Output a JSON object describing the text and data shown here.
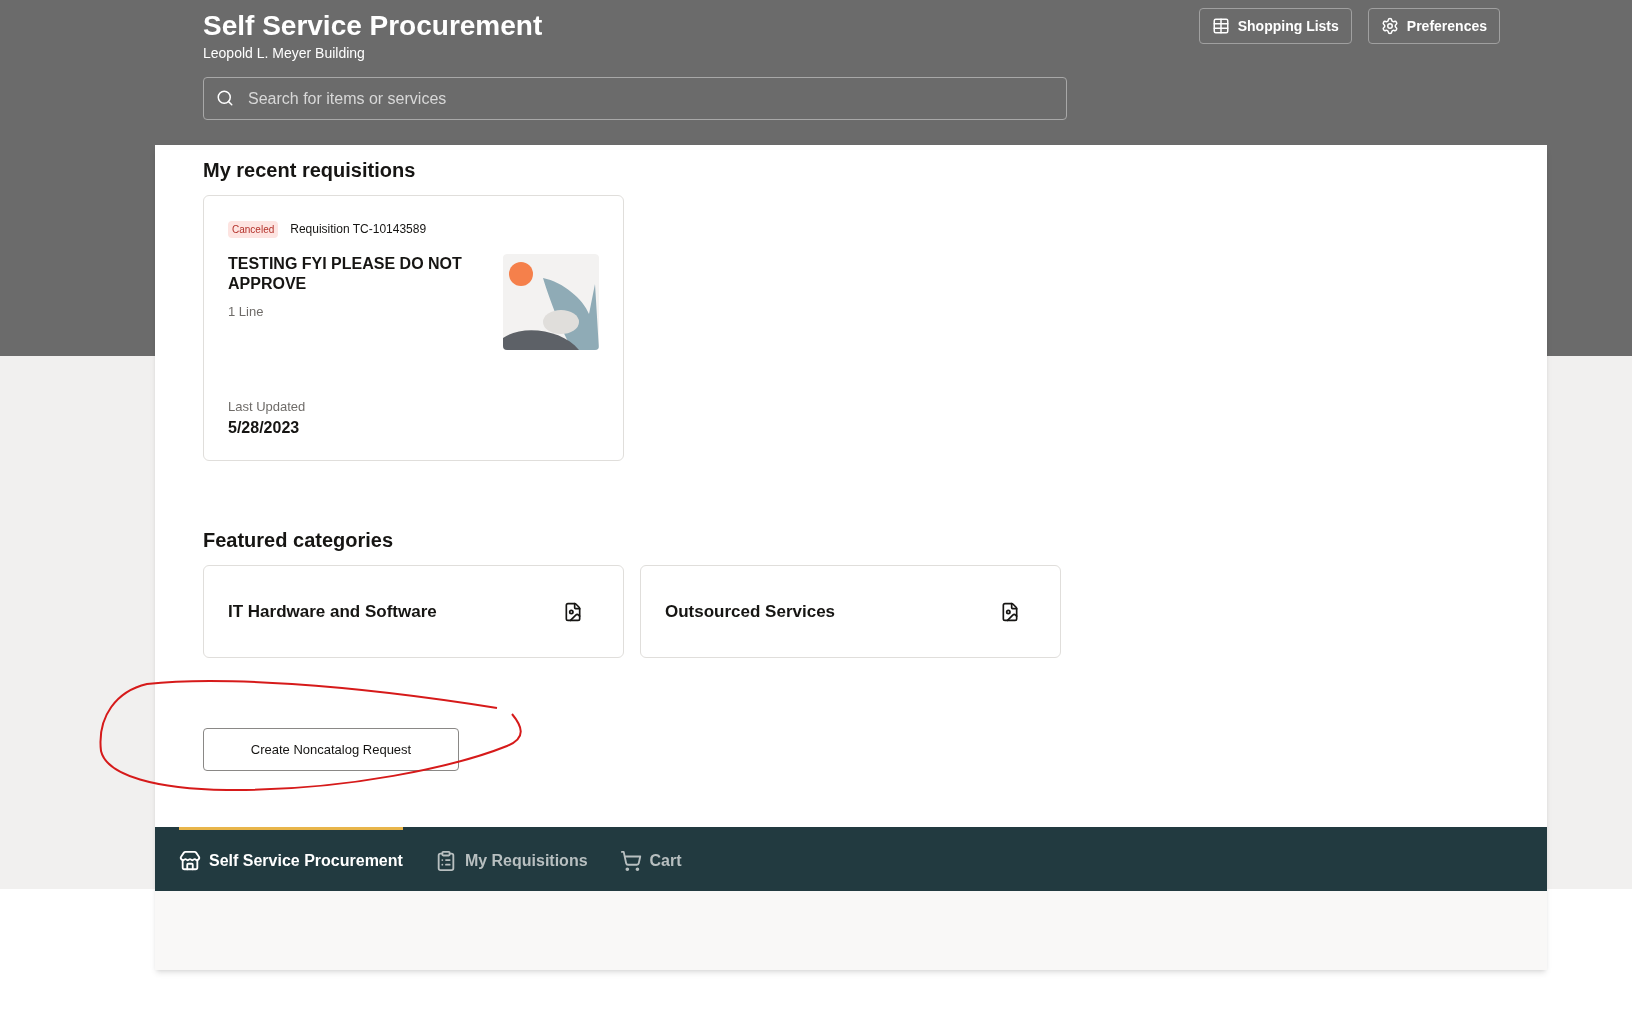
{
  "header": {
    "title": "Self Service Procurement",
    "subtitle": "Leopold L. Meyer Building",
    "search": {
      "placeholder": "Search for items or services"
    },
    "buttons": [
      {
        "kind": "list",
        "label": "Shopping Lists"
      },
      {
        "kind": "settings",
        "label": "Preferences"
      }
    ]
  },
  "recent": {
    "heading": "My recent requisitions",
    "cards": [
      {
        "status": "Canceled",
        "number": "Requisition TC-10143589",
        "title": "TESTING FYI PLEASE DO NOT APPROVE",
        "lines": "1 Line",
        "updated_label": "Last Updated",
        "updated": "5/28/2023"
      }
    ]
  },
  "featured": {
    "heading": "Featured categories",
    "categories": [
      {
        "name": "IT Hardware and Software"
      },
      {
        "name": "Outsourced Services"
      }
    ]
  },
  "noncatalog_button": "Create Noncatalog Request",
  "nav": [
    {
      "kind": "store",
      "label": "Self Service Procurement",
      "selected": true
    },
    {
      "kind": "clipboard",
      "label": "My Requisitions",
      "selected": false
    },
    {
      "kind": "cart",
      "label": "Cart",
      "selected": false
    }
  ]
}
